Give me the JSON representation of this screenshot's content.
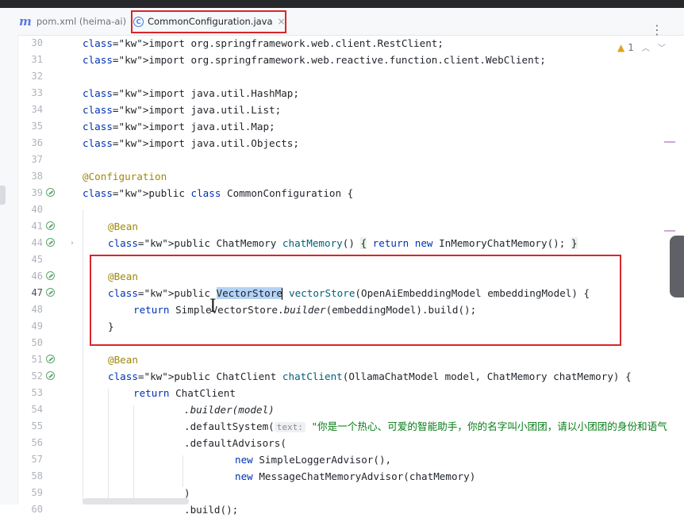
{
  "tabs": [
    {
      "label": "pom.xml (heima-ai)",
      "icon": "maven-icon",
      "active": false
    },
    {
      "label": "CommonConfiguration.java",
      "icon": "class-icon",
      "active": true,
      "icon_glyph": "C",
      "close": "×"
    }
  ],
  "toolbar": {
    "more_glyph": "⋮"
  },
  "inspection": {
    "warning_count": "1",
    "up": "︿",
    "down": "﹀"
  },
  "colors": {
    "highlight_box": "#d8262a",
    "keyword": "#0033b3",
    "annotation": "#9e880d",
    "string": "#067d17"
  },
  "editor": {
    "lines": [
      {
        "n": "30",
        "code": [
          "import org.springframework.web.client.RestClient;"
        ]
      },
      {
        "n": "31",
        "code": [
          "import org.springframework.web.reactive.function.client.WebClient;"
        ]
      },
      {
        "n": "32",
        "code": [
          ""
        ]
      },
      {
        "n": "33",
        "code": [
          "import java.util.HashMap;"
        ]
      },
      {
        "n": "34",
        "code": [
          "import java.util.List;"
        ]
      },
      {
        "n": "35",
        "code": [
          "import java.util.Map;"
        ]
      },
      {
        "n": "36",
        "code": [
          "import java.util.Objects;"
        ]
      },
      {
        "n": "37",
        "code": [
          ""
        ]
      },
      {
        "n": "38",
        "code": [
          "@Configuration"
        ]
      },
      {
        "n": "39",
        "code": [
          "public class CommonConfiguration {"
        ]
      },
      {
        "n": "40",
        "code": [
          ""
        ]
      },
      {
        "n": "41",
        "code": [
          "@Bean"
        ]
      },
      {
        "n": "44",
        "code": [
          "public ChatMemory chatMemory() { return new InMemoryChatMemory(); }"
        ]
      },
      {
        "n": "45",
        "code": [
          ""
        ]
      },
      {
        "n": "46",
        "code": [
          "@Bean"
        ]
      },
      {
        "n": "47",
        "code": [
          "public VectorStore vectorStore(OpenAiEmbeddingModel embeddingModel) {"
        ]
      },
      {
        "n": "48",
        "code": [
          "return SimpleVectorStore.builder(embeddingModel).build();"
        ]
      },
      {
        "n": "49",
        "code": [
          "}"
        ]
      },
      {
        "n": "50",
        "code": [
          ""
        ]
      },
      {
        "n": "51",
        "code": [
          "@Bean"
        ]
      },
      {
        "n": "52",
        "code": [
          "public ChatClient chatClient(OllamaChatModel model, ChatMemory chatMemory) {"
        ]
      },
      {
        "n": "53",
        "code": [
          "return ChatClient"
        ]
      },
      {
        "n": "54",
        "code": [
          ".builder(model)"
        ]
      },
      {
        "n": "55",
        "code": [
          ".defaultSystem(",
          "text:",
          "\"你是一个热心、可爱的智能助手，你的名字叫小团团，请以小团团的身份和语气"
        ]
      },
      {
        "n": "56",
        "code": [
          ".defaultAdvisors("
        ]
      },
      {
        "n": "57",
        "code": [
          "new SimpleLoggerAdvisor(),"
        ]
      },
      {
        "n": "58",
        "code": [
          "new MessageChatMemoryAdvisor(chatMemory)"
        ]
      },
      {
        "n": "59",
        "code": [
          ")"
        ]
      },
      {
        "n": "60",
        "code": [
          ".build();"
        ]
      }
    ]
  }
}
